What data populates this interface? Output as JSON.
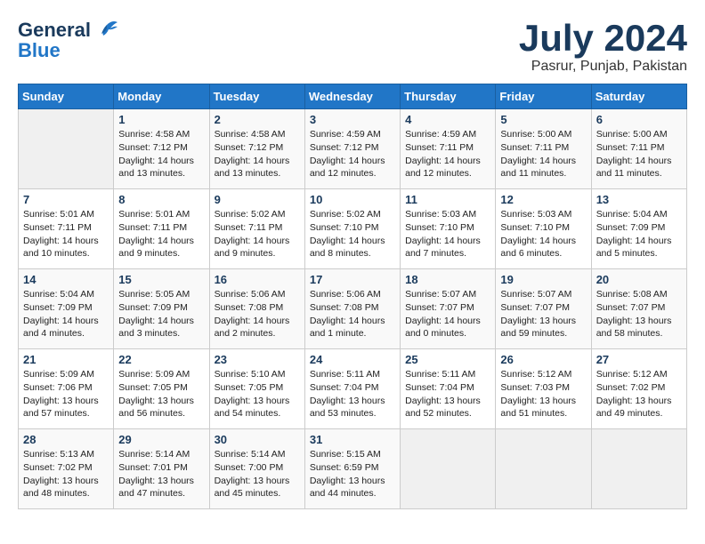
{
  "header": {
    "logo_line1": "General",
    "logo_line2": "Blue",
    "month_year": "July 2024",
    "location": "Pasrur, Punjab, Pakistan"
  },
  "days_of_week": [
    "Sunday",
    "Monday",
    "Tuesday",
    "Wednesday",
    "Thursday",
    "Friday",
    "Saturday"
  ],
  "weeks": [
    [
      {
        "day": "",
        "info": ""
      },
      {
        "day": "1",
        "info": "Sunrise: 4:58 AM\nSunset: 7:12 PM\nDaylight: 14 hours\nand 13 minutes."
      },
      {
        "day": "2",
        "info": "Sunrise: 4:58 AM\nSunset: 7:12 PM\nDaylight: 14 hours\nand 13 minutes."
      },
      {
        "day": "3",
        "info": "Sunrise: 4:59 AM\nSunset: 7:12 PM\nDaylight: 14 hours\nand 12 minutes."
      },
      {
        "day": "4",
        "info": "Sunrise: 4:59 AM\nSunset: 7:11 PM\nDaylight: 14 hours\nand 12 minutes."
      },
      {
        "day": "5",
        "info": "Sunrise: 5:00 AM\nSunset: 7:11 PM\nDaylight: 14 hours\nand 11 minutes."
      },
      {
        "day": "6",
        "info": "Sunrise: 5:00 AM\nSunset: 7:11 PM\nDaylight: 14 hours\nand 11 minutes."
      }
    ],
    [
      {
        "day": "7",
        "info": "Sunrise: 5:01 AM\nSunset: 7:11 PM\nDaylight: 14 hours\nand 10 minutes."
      },
      {
        "day": "8",
        "info": "Sunrise: 5:01 AM\nSunset: 7:11 PM\nDaylight: 14 hours\nand 9 minutes."
      },
      {
        "day": "9",
        "info": "Sunrise: 5:02 AM\nSunset: 7:11 PM\nDaylight: 14 hours\nand 9 minutes."
      },
      {
        "day": "10",
        "info": "Sunrise: 5:02 AM\nSunset: 7:10 PM\nDaylight: 14 hours\nand 8 minutes."
      },
      {
        "day": "11",
        "info": "Sunrise: 5:03 AM\nSunset: 7:10 PM\nDaylight: 14 hours\nand 7 minutes."
      },
      {
        "day": "12",
        "info": "Sunrise: 5:03 AM\nSunset: 7:10 PM\nDaylight: 14 hours\nand 6 minutes."
      },
      {
        "day": "13",
        "info": "Sunrise: 5:04 AM\nSunset: 7:09 PM\nDaylight: 14 hours\nand 5 minutes."
      }
    ],
    [
      {
        "day": "14",
        "info": "Sunrise: 5:04 AM\nSunset: 7:09 PM\nDaylight: 14 hours\nand 4 minutes."
      },
      {
        "day": "15",
        "info": "Sunrise: 5:05 AM\nSunset: 7:09 PM\nDaylight: 14 hours\nand 3 minutes."
      },
      {
        "day": "16",
        "info": "Sunrise: 5:06 AM\nSunset: 7:08 PM\nDaylight: 14 hours\nand 2 minutes."
      },
      {
        "day": "17",
        "info": "Sunrise: 5:06 AM\nSunset: 7:08 PM\nDaylight: 14 hours\nand 1 minute."
      },
      {
        "day": "18",
        "info": "Sunrise: 5:07 AM\nSunset: 7:07 PM\nDaylight: 14 hours\nand 0 minutes."
      },
      {
        "day": "19",
        "info": "Sunrise: 5:07 AM\nSunset: 7:07 PM\nDaylight: 13 hours\nand 59 minutes."
      },
      {
        "day": "20",
        "info": "Sunrise: 5:08 AM\nSunset: 7:07 PM\nDaylight: 13 hours\nand 58 minutes."
      }
    ],
    [
      {
        "day": "21",
        "info": "Sunrise: 5:09 AM\nSunset: 7:06 PM\nDaylight: 13 hours\nand 57 minutes."
      },
      {
        "day": "22",
        "info": "Sunrise: 5:09 AM\nSunset: 7:05 PM\nDaylight: 13 hours\nand 56 minutes."
      },
      {
        "day": "23",
        "info": "Sunrise: 5:10 AM\nSunset: 7:05 PM\nDaylight: 13 hours\nand 54 minutes."
      },
      {
        "day": "24",
        "info": "Sunrise: 5:11 AM\nSunset: 7:04 PM\nDaylight: 13 hours\nand 53 minutes."
      },
      {
        "day": "25",
        "info": "Sunrise: 5:11 AM\nSunset: 7:04 PM\nDaylight: 13 hours\nand 52 minutes."
      },
      {
        "day": "26",
        "info": "Sunrise: 5:12 AM\nSunset: 7:03 PM\nDaylight: 13 hours\nand 51 minutes."
      },
      {
        "day": "27",
        "info": "Sunrise: 5:12 AM\nSunset: 7:02 PM\nDaylight: 13 hours\nand 49 minutes."
      }
    ],
    [
      {
        "day": "28",
        "info": "Sunrise: 5:13 AM\nSunset: 7:02 PM\nDaylight: 13 hours\nand 48 minutes."
      },
      {
        "day": "29",
        "info": "Sunrise: 5:14 AM\nSunset: 7:01 PM\nDaylight: 13 hours\nand 47 minutes."
      },
      {
        "day": "30",
        "info": "Sunrise: 5:14 AM\nSunset: 7:00 PM\nDaylight: 13 hours\nand 45 minutes."
      },
      {
        "day": "31",
        "info": "Sunrise: 5:15 AM\nSunset: 6:59 PM\nDaylight: 13 hours\nand 44 minutes."
      },
      {
        "day": "",
        "info": ""
      },
      {
        "day": "",
        "info": ""
      },
      {
        "day": "",
        "info": ""
      }
    ]
  ]
}
